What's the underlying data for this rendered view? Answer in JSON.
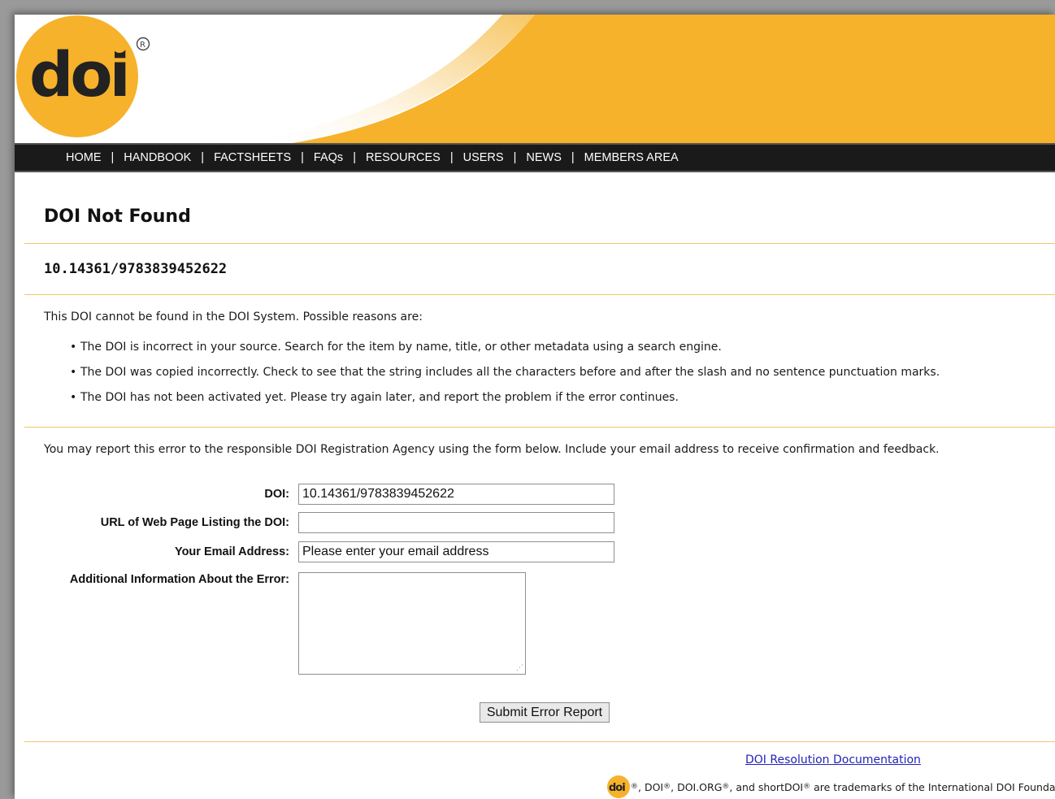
{
  "colors": {
    "brand_orange": "#f7b22b",
    "nav_bg": "#1a1a1a",
    "divider": "#f0c66b",
    "link": "#2323b8"
  },
  "logo": {
    "text": "doi",
    "registered": "®"
  },
  "nav": {
    "items": [
      {
        "label": "HOME"
      },
      {
        "label": "HANDBOOK"
      },
      {
        "label": "FACTSHEETS"
      },
      {
        "label": "FAQs"
      },
      {
        "label": "RESOURCES"
      },
      {
        "label": "USERS"
      },
      {
        "label": "NEWS"
      },
      {
        "label": "MEMBERS AREA"
      }
    ],
    "separator": "|"
  },
  "page": {
    "title": "DOI Not Found",
    "doi": "10.14361/9783839452622",
    "intro": "This DOI cannot be found in the DOI System. Possible reasons are:",
    "reasons": [
      "The DOI is incorrect in your source. Search for the item by name, title, or other metadata using a search engine.",
      "The DOI was copied incorrectly. Check to see that the string includes all the characters before and after the slash and no sentence punctuation marks.",
      "The DOI has not been activated yet. Please try again later, and report the problem if the error continues."
    ],
    "report_text": "You may report this error to the responsible DOI Registration Agency using the form below. Include your email address to receive confirmation and feedback."
  },
  "form": {
    "doi_label": "DOI:",
    "doi_value": "10.14361/9783839452622",
    "url_label": "URL of Web Page Listing the DOI:",
    "url_value": "",
    "email_label": "Your Email Address:",
    "email_value": "Please enter your email address",
    "info_label": "Additional Information About the Error:",
    "info_value": "",
    "submit_label": "Submit Error Report"
  },
  "footer": {
    "doc_link": "DOI Resolution Documentation",
    "trademark_logo": "doi",
    "trademark_parts": [
      "DOI",
      "DOI.ORG",
      "and shortDOI",
      "are trademarks of the International DOI Foundation."
    ],
    "reg": "®"
  }
}
